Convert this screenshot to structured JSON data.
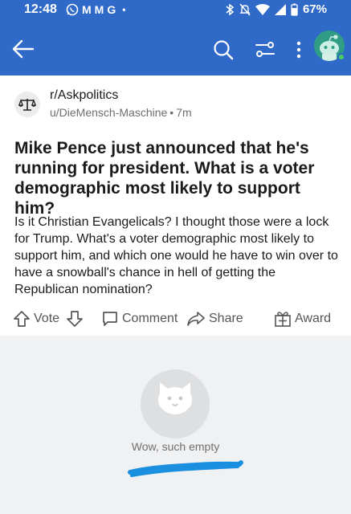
{
  "status_bar": {
    "time": "12:48",
    "notification_icons": [
      "whatsapp-icon",
      "gmail-icon",
      "gmail-icon",
      "google-icon",
      "dot-icon"
    ],
    "notification_glyphs": [
      "M",
      "M",
      "G",
      "•"
    ],
    "system_icons": [
      "bluetooth-icon",
      "mute-icon",
      "wifi-icon",
      "signal-icon",
      "battery-icon"
    ],
    "battery": "67%"
  },
  "app_bar": {
    "background": "#2f6ac9",
    "icons": [
      "back-arrow-icon",
      "search-icon",
      "filter-icon",
      "more-vertical-icon",
      "avatar"
    ]
  },
  "post": {
    "subreddit": "r/Askpolitics",
    "author": "u/DieMensch-Maschine",
    "separator": "•",
    "age": "7m",
    "title": "Mike Pence just announced that he's running for president. What is a voter demographic most likely to support him?",
    "body": "Is it Christian Evangelicals?  I thought those were a lock for Trump.  What's a voter demographic most likely to support him, and which one would he have to win over to have a snowball's chance in hell of getting the Republican nomination?"
  },
  "actions": {
    "vote_label": "Vote",
    "comment_label": "Comment",
    "share_label": "Share",
    "award_label": "Award"
  },
  "empty_state": {
    "message": "Wow, such empty",
    "scribble_color": "#1a8fe0"
  }
}
